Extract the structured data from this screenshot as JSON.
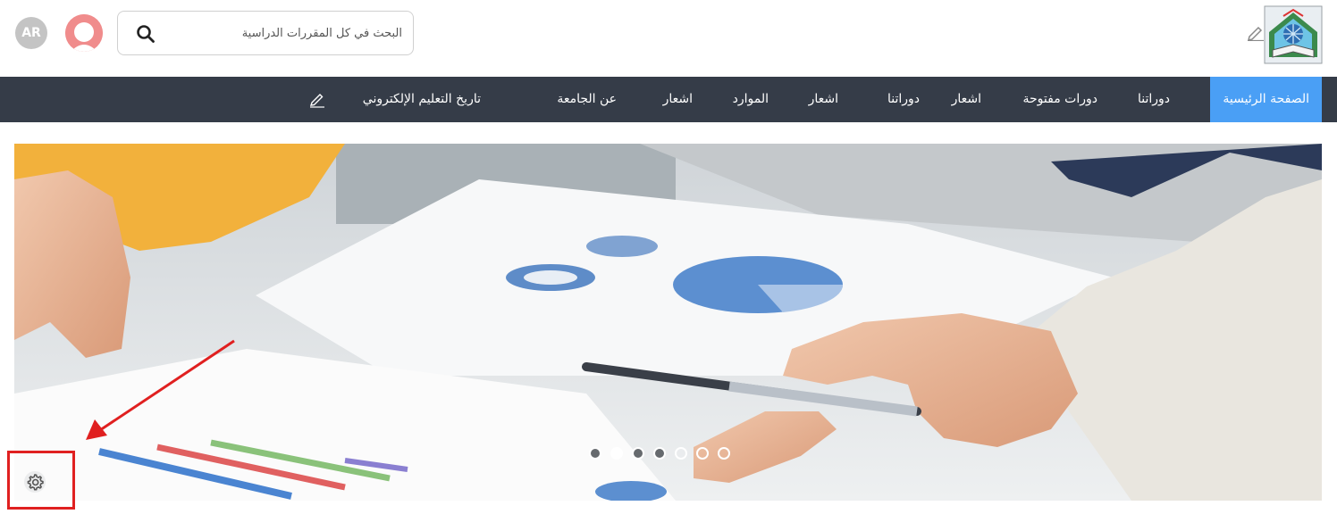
{
  "header": {
    "language_label": "AR",
    "search": {
      "placeholder": "البحث في كل المقررات الدراسية"
    },
    "icons": {
      "search": "search-icon",
      "avatar": "user-avatar",
      "logo": "university-logo",
      "edit": "pencil-icon"
    }
  },
  "nav": {
    "items": [
      {
        "label": "الصفحة الرئيسية",
        "active": true
      },
      {
        "label": "دوراتنا"
      },
      {
        "label": "دورات مفتوحة"
      },
      {
        "label": "اشعار"
      },
      {
        "label": "دوراتنا"
      },
      {
        "label": "اشعار"
      },
      {
        "label": "الموارد"
      },
      {
        "label": "اشعار"
      },
      {
        "label": "عن الجامعة"
      },
      {
        "label": "تاريخ التعليم الإلكتروني"
      }
    ],
    "edit_icon": "pencil-icon"
  },
  "carousel": {
    "slide_count": 7,
    "active_index": 1,
    "settings_icon": "gear-icon"
  },
  "colors": {
    "nav_bg": "#353c48",
    "nav_active": "#4a9ff5",
    "annotation": "#e02020",
    "avatar": "#f08c8c",
    "lang_badge": "#c4c4c4"
  }
}
